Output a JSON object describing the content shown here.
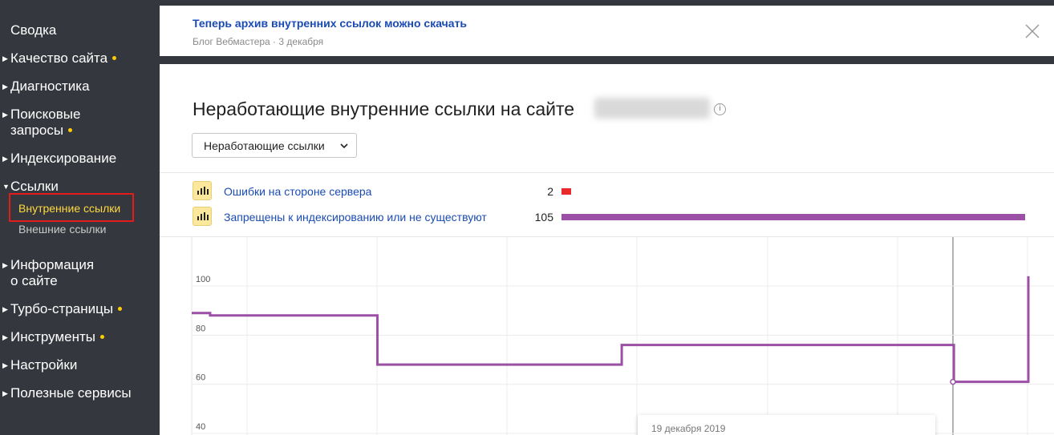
{
  "sidebar": {
    "summary": "Сводка",
    "items": [
      {
        "label": "Качество сайта",
        "dot": true
      },
      {
        "label": "Диагностика",
        "dot": false
      },
      {
        "label": "Поисковые",
        "label2": "запросы",
        "dot": true
      },
      {
        "label": "Индексирование",
        "dot": false
      },
      {
        "label": "Ссылки",
        "dot": false,
        "expanded": true
      },
      {
        "label": "Информация",
        "label2": "о сайте",
        "dot": false
      },
      {
        "label": "Турбо-страницы",
        "dot": true
      },
      {
        "label": "Инструменты",
        "dot": true
      },
      {
        "label": "Настройки",
        "dot": false
      },
      {
        "label": "Полезные сервисы",
        "dot": false
      }
    ],
    "links_sub": {
      "internal": "Внутренние ссылки",
      "external": "Внешние ссылки"
    }
  },
  "notice": {
    "title": "Теперь архив внутренних ссылок можно скачать",
    "meta": "Блог Вебмастера · 3 декабря"
  },
  "page": {
    "title": "Неработающие внутренние ссылки на сайте",
    "info_icon": "i",
    "dropdown": "Неработающие ссылки"
  },
  "legend": [
    {
      "label": "Ошибки на стороне сервера",
      "count": "2",
      "color": "#e82a2a",
      "fraction": 0.019
    },
    {
      "label": "Запрещены к индексированию или не существуют",
      "count": "105",
      "color": "#9b4fa5",
      "fraction": 1.0
    }
  ],
  "chart_data": {
    "type": "line",
    "y_ticks": [
      "100",
      "80",
      "60",
      "40"
    ],
    "series": [
      {
        "color": "#9b4fa5",
        "steps": [
          {
            "from": 0,
            "to": 0.022,
            "y": 89
          },
          {
            "from": 0.022,
            "to": 0.222,
            "y": 88
          },
          {
            "from": 0.222,
            "to": 0.514,
            "y": 68
          },
          {
            "from": 0.514,
            "to": 0.911,
            "y": 76
          },
          {
            "from": 0.911,
            "to": 1.0,
            "y": 61
          },
          {
            "from": 1.0,
            "to": 1.0,
            "y": 104
          }
        ]
      }
    ],
    "tooltip_date": "19 декабря 2019"
  }
}
